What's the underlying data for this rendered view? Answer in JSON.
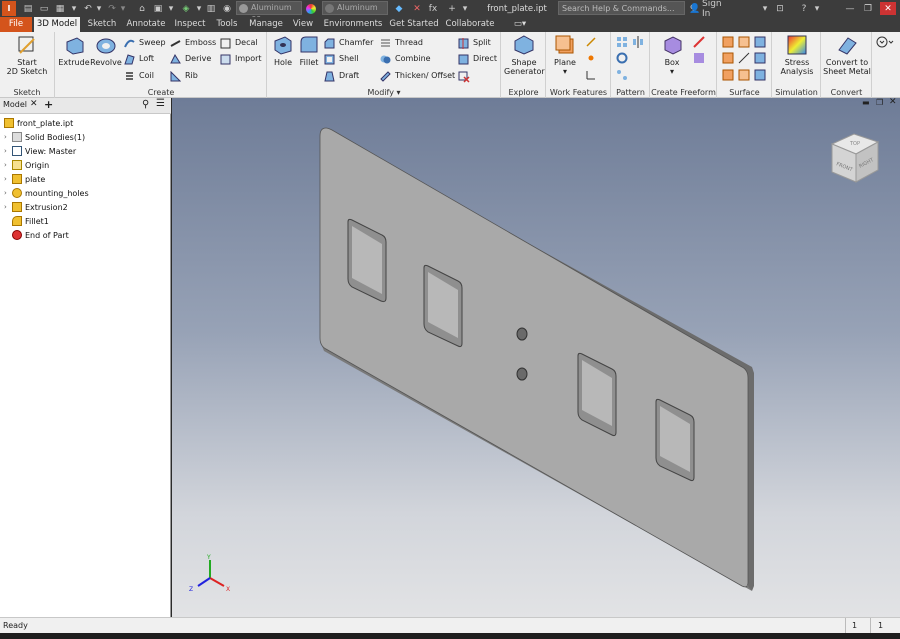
{
  "title_bar": {
    "material_combo": "Aluminum 60",
    "appearance_combo": "Aluminum",
    "filename": "front_plate.ipt",
    "search_placeholder": "Search Help & Commands...",
    "sign_in": "Sign In",
    "accent": "#d4541c"
  },
  "tabs": [
    "File",
    "3D Model",
    "Sketch",
    "Annotate",
    "Inspect",
    "Tools",
    "Manage",
    "View",
    "Environments",
    "Get Started",
    "Collaborate"
  ],
  "active_tab": "3D Model",
  "ribbon": {
    "sketch": {
      "label": "Sketch",
      "start": "Start",
      "start2": "2D Sketch"
    },
    "create": {
      "label": "Create",
      "extrude": "Extrude",
      "revolve": "Revolve",
      "sweep": "Sweep",
      "loft": "Loft",
      "coil": "Coil",
      "emboss": "Emboss",
      "derive": "Derive",
      "rib": "Rib",
      "decal": "Decal",
      "import": "Import"
    },
    "modify": {
      "label": "Modify",
      "hole": "Hole",
      "fillet": "Fillet",
      "chamfer": "Chamfer",
      "shell": "Shell",
      "draft": "Draft",
      "thread": "Thread",
      "combine": "Combine",
      "thicken": "Thicken/ Offset",
      "split": "Split",
      "direct": "Direct"
    },
    "explore": {
      "label": "Explore",
      "shape": "Shape",
      "shape2": "Generator"
    },
    "work": {
      "label": "Work Features",
      "plane": "Plane"
    },
    "pattern": {
      "label": "Pattern"
    },
    "freeform": {
      "label": "Create Freeform",
      "box": "Box"
    },
    "surface": {
      "label": "Surface"
    },
    "simulation": {
      "label": "Simulation",
      "stress": "Stress",
      "stress2": "Analysis"
    },
    "convert": {
      "label": "Convert",
      "convert1": "Convert to",
      "convert2": "Sheet Metal"
    }
  },
  "browser": {
    "tab": "Model",
    "plus": "+",
    "root": "front_plate.ipt",
    "items": [
      "Solid Bodies(1)",
      "View: Master",
      "Origin",
      "plate",
      "mounting_holes",
      "Extrusion2",
      "Fillet1",
      "End of Part"
    ]
  },
  "viewcube": {
    "top": "TOP",
    "front": "FRONT",
    "right": "RIGHT"
  },
  "triad": {
    "x": "X",
    "y": "Y",
    "z": "Z"
  },
  "status": {
    "text": "Ready",
    "count1": "1",
    "count2": "1"
  }
}
